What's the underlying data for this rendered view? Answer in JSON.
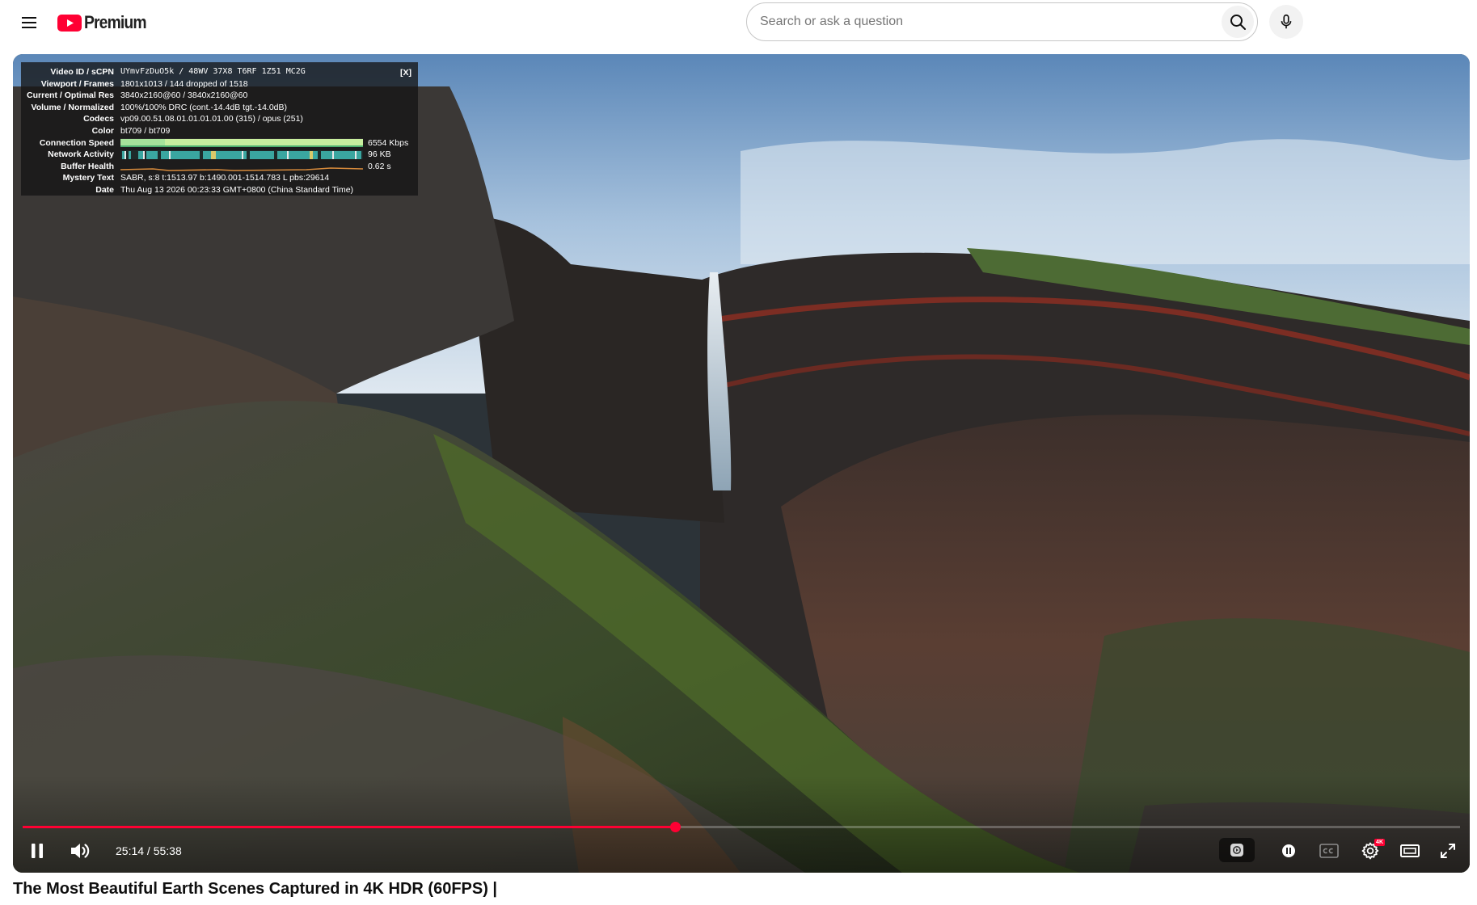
{
  "header": {
    "logo_text": "Premium",
    "search": {
      "placeholder": "Search or ask a question",
      "value": ""
    },
    "icons": [
      "menu-icon",
      "youtube-logo-icon",
      "search-icon",
      "microphone-icon"
    ]
  },
  "stats": {
    "close_label": "[X]",
    "rows": [
      {
        "label": "Video ID / sCPN",
        "value": "UYmvFzDuO5k / 48WV 37X8 T6RF 1Z51 MC2G"
      },
      {
        "label": "Viewport / Frames",
        "value": "1801x1013 / 144 dropped of 1518"
      },
      {
        "label": "Current / Optimal Res",
        "value": "3840x2160@60 / 3840x2160@60"
      },
      {
        "label": "Volume / Normalized",
        "value": "100%/100% DRC (cont.-14.4dB tgt.-14.0dB)"
      },
      {
        "label": "Codecs",
        "value": "vp09.00.51.08.01.01.01.01.00 (315) / opus (251)"
      },
      {
        "label": "Color",
        "value": "bt709 / bt709"
      },
      {
        "label": "Connection Speed",
        "value": "6554 Kbps"
      },
      {
        "label": "Network Activity",
        "value": "96 KB"
      },
      {
        "label": "Buffer Health",
        "value": "0.62 s"
      },
      {
        "label": "Mystery Text",
        "value": "SABR, s:8 t:1513.97 b:1490.001-1514.783 L pbs:29614"
      },
      {
        "label": "Date",
        "value": "Thu Aug 13 2026 00:23:33 GMT+0800 (China Standard Time)"
      }
    ]
  },
  "player": {
    "time_current": "25:14",
    "time_duration": "55:38",
    "time_separator": " / ",
    "progress_fraction": 0.4536,
    "buffered_fraction": 0.455,
    "accent_color": "#ff0033",
    "badge_text": "4K",
    "controls": [
      "pause-icon",
      "volume-icon",
      "autoplay-icon",
      "pause-small-icon",
      "subtitles-icon",
      "settings-icon",
      "theater-mode-icon",
      "fullscreen-icon"
    ]
  },
  "video": {
    "title": "The Most Beautiful Earth Scenes Captured in 4K HDR (60FPS) |"
  }
}
